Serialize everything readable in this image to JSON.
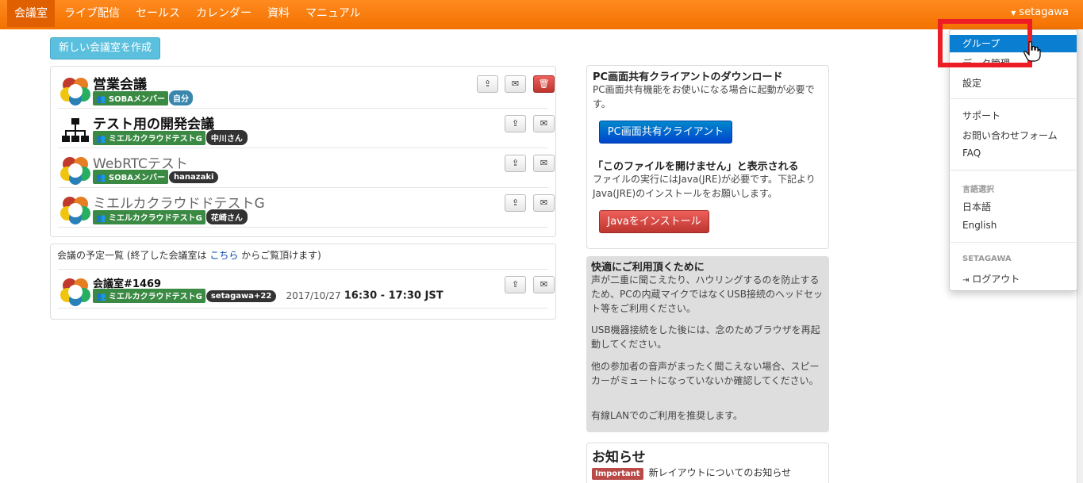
{
  "nav": {
    "items": [
      "会議室",
      "ライブ配信",
      "セールス",
      "カレンダー",
      "資料",
      "マニュアル"
    ],
    "user": "setagawa"
  },
  "create_button": "新しい会議室を作成",
  "rooms": [
    {
      "name": "営業会議",
      "group": "SOBAメンバー",
      "owner": "自分",
      "icon": "flower-logo-icon",
      "owner_style": "blue"
    },
    {
      "name": "テスト用の開発会議",
      "group": "ミエルカクラウドテストG",
      "owner": "中川さん",
      "icon": "org-chart-icon",
      "owner_style": "dark"
    },
    {
      "name": "WebRTCテスト",
      "group": "SOBAメンバー",
      "owner": "hanazaki",
      "icon": "flower-logo-icon",
      "owner_style": "dark"
    },
    {
      "name": "ミエルカクラウドドテストG",
      "group": "ミエルカクラウドテストG",
      "owner": "花崎さん",
      "icon": "flower-logo-icon",
      "owner_style": "dark"
    }
  ],
  "schedule": {
    "header_before": "会議の予定一覧 (終了した会議室は",
    "header_link": "こちら",
    "header_after": "からご覧頂けます)",
    "item": {
      "name": "会議室#1469",
      "group": "ミエルカクラウドテストG",
      "owner": "setagawa+22",
      "date": "2017/10/27",
      "time": "16:30 - 17:30 JST"
    }
  },
  "download_panel": {
    "title": "PC画面共有クライアントのダウンロード",
    "text": "PC画面共有機能をお使いになる場合に起動が必要です。",
    "button": "PC画面共有クライアント",
    "warn_title": "「このファイルを開けません」と表示される",
    "warn_text": "ファイルの実行にはJava(JRE)が必要です。下記よりJava(JRE)のインストールをお願いします。",
    "java_button": "Javaをインストール"
  },
  "tips_panel": {
    "title": "快適にご利用頂くために",
    "paragraphs": [
      "声が二重に聞こえたり、ハウリングするのを防止するため、PCの内蔵マイクではなくUSB接続のヘッドセット等をご利用ください。",
      "USB機器接続をした後には、念のためブラウザを再起動してください。",
      "他の参加者の音声がまったく聞こえない場合、スピーカーがミュートになっていないか確認してください。",
      "有線LANでのご利用を推奨します。"
    ]
  },
  "news_panel": {
    "title": "お知らせ",
    "badge": "Important",
    "text": "新レイアウトについてのお知らせ"
  },
  "dropdown": {
    "items": [
      "グループ",
      "データ管理",
      "設定",
      "サポート",
      "お問い合わせフォーム",
      "FAQ"
    ],
    "lang_header": "言語選択",
    "langs": [
      "日本語",
      "English"
    ],
    "user_header": "SETAGAWA",
    "logout": "ログアウト"
  },
  "colors": {
    "nav": "#f27200",
    "highlight": "#ee1c25",
    "active_item": "#0a7fd1"
  }
}
